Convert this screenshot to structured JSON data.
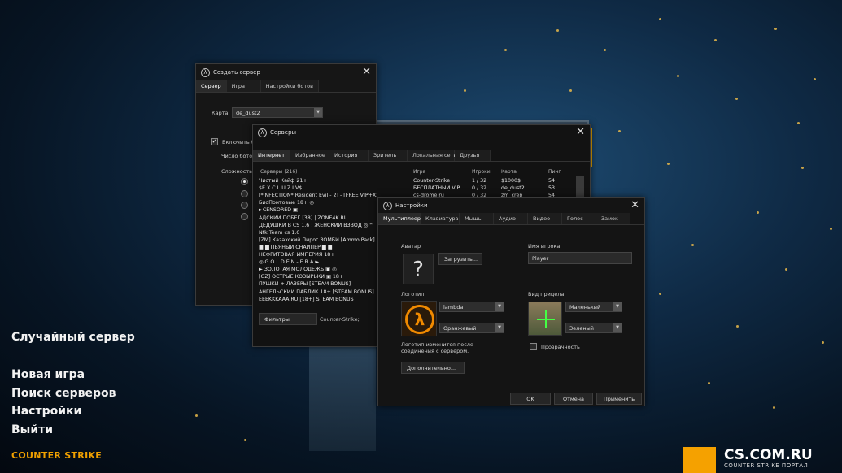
{
  "main_menu": {
    "random_server": "Случайный сервер",
    "new_game": "Новая игра",
    "find_servers": "Поиск серверов",
    "settings": "Настройки",
    "quit": "Выйти"
  },
  "logo_text": "COUNTER STRIKE",
  "site": {
    "name": "CS.COM.RU",
    "tagline": "COUNTER STRIKE ПОРТАЛ"
  },
  "create_server": {
    "title": "Создать сервер",
    "tabs": [
      "Сервер",
      "Игра",
      "Настройки ботов"
    ],
    "map_label": "Карта",
    "map_value": "de_dust2",
    "enable_bots": "Включить ботов в эту игру",
    "bot_count_label": "Число ботов",
    "difficulty_label": "Сложность"
  },
  "servers": {
    "title": "Серверы",
    "tabs": [
      "Интернет",
      "Избранное",
      "История",
      "Зритель",
      "Локальная сеть",
      "Друзья"
    ],
    "columns": [
      "Серверы (216)",
      "Игра",
      "Игроки",
      "Карта",
      "Пинг"
    ],
    "rows": [
      {
        "name": "Чистый Кайф 21+",
        "game": "Counter-Strike",
        "players": "1 / 32",
        "map": "$1000$",
        "ping": "54"
      },
      {
        "name": "$E X C L U Z I V$",
        "game": "БЕСПЛАТНЫЙ VIP",
        "players": "0 / 32",
        "map": "de_dust2",
        "ping": "53"
      },
      {
        "name": "[*INFECTION* Resident Evil - 2] - [FREE VIP+X2]",
        "game": "cs-drome.ru",
        "players": "0 / 32",
        "map": "zm_crep",
        "ping": "54"
      },
      {
        "name": "БиоПонтовые 18+ ◎",
        "game": "",
        "players": "",
        "map": "",
        "ping": ""
      },
      {
        "name": "►CENSORED ▣",
        "game": "",
        "players": "",
        "map": "",
        "ping": ""
      },
      {
        "name": "АДСКИЙ ПОБЕГ [38] | ZONE4K.RU",
        "game": "",
        "players": "",
        "map": "",
        "ping": ""
      },
      {
        "name": "ДЕДУШКИ В CS 1.6 : ЖЕНСКИЙ ВЗВОД ◎™",
        "game": "",
        "players": "",
        "map": "",
        "ping": ""
      },
      {
        "name": "Ntk Team cs 1.6",
        "game": "",
        "players": "",
        "map": "",
        "ping": ""
      },
      {
        "name": "[ZM] Казахский Пирог ЗОМБИ [Ammo Pack]",
        "game": "",
        "players": "",
        "map": "",
        "ping": ""
      },
      {
        "name": "■ █ ПЬЯНЫЙ СНАЙПЕР █ ■",
        "game": "",
        "players": "",
        "map": "",
        "ping": ""
      },
      {
        "name": "НЕФРИТОВАЯ ИМПЕРИЯ 18+",
        "game": "",
        "players": "",
        "map": "",
        "ping": ""
      },
      {
        "name": "◎ G O L D E N - E R A ►",
        "game": "",
        "players": "",
        "map": "",
        "ping": ""
      },
      {
        "name": "► ЗОЛОТАЯ МОЛОДЁЖЬ ▣ ◎",
        "game": "",
        "players": "",
        "map": "",
        "ping": ""
      },
      {
        "name": "[GZ] ОСТРЫЕ КОЗЫРЬКИ ▣ 18+",
        "game": "",
        "players": "",
        "map": "",
        "ping": ""
      },
      {
        "name": "ПУШКИ + ЛАЗЕРЫ [STEAM BONUS]",
        "game": "",
        "players": "",
        "map": "",
        "ping": ""
      },
      {
        "name": "АНГЕЛЬСКИЙ ПАБЛИК 18+ [STEAM BONUS]",
        "game": "",
        "players": "",
        "map": "",
        "ping": ""
      },
      {
        "name": "EEEKKKAAA.RU [18+] STEAM BONUS",
        "game": "",
        "players": "",
        "map": "",
        "ping": ""
      }
    ],
    "filters_button": "Фильтры",
    "game_filter": "Counter-Strike;"
  },
  "settings_dialog": {
    "title": "Настройки",
    "tabs": [
      "Мультиплеер",
      "Клавиатура",
      "Мышь",
      "Аудио",
      "Видео",
      "Голос",
      "Замок"
    ],
    "avatar_label": "Аватар",
    "avatar_placeholder": "?",
    "upload_button": "Загрузить...",
    "player_name_label": "Имя игрока",
    "player_name_value": "Player",
    "logo_label": "Логотип",
    "logo_value": "lambda",
    "logo_color": "Оранжевый",
    "logo_note": "Логотип изменится после соединения с сервером.",
    "advanced_button": "Дополнительно...",
    "crosshair_label": "Вид прицела",
    "crosshair_size": "Маленький",
    "crosshair_color": "Зеленый",
    "transparency_label": "Прозрачность",
    "ok_button": "OK",
    "cancel_button": "Отмена",
    "apply_button": "Применить"
  },
  "colors": {
    "accent": "#f5a100",
    "dialog_bg": "#161616"
  }
}
